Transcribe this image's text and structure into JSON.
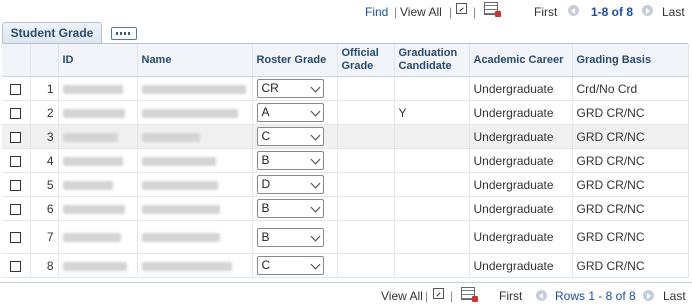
{
  "toolbar": {
    "find": "Find",
    "view_all": "View All",
    "separator": "|",
    "first": "First",
    "range": "1-8 of 8",
    "last": "Last"
  },
  "tab": {
    "label": "Student Grade"
  },
  "columns": [
    "ID",
    "Name",
    "Roster Grade",
    "Official Grade",
    "Graduation Candidate",
    "Academic Career",
    "Grading Basis"
  ],
  "rows": [
    {
      "num": "1",
      "roster_grade": "CR",
      "official_grade": "",
      "grad_candidate": "",
      "career": "Undergraduate",
      "basis": "Crd/No Crd"
    },
    {
      "num": "2",
      "roster_grade": "A",
      "official_grade": "",
      "grad_candidate": "Y",
      "career": "Undergraduate",
      "basis": "GRD CR/NC"
    },
    {
      "num": "3",
      "roster_grade": "C",
      "official_grade": "",
      "grad_candidate": "",
      "career": "Undergraduate",
      "basis": "GRD CR/NC"
    },
    {
      "num": "4",
      "roster_grade": "B",
      "official_grade": "",
      "grad_candidate": "",
      "career": "Undergraduate",
      "basis": "GRD CR/NC"
    },
    {
      "num": "5",
      "roster_grade": "D",
      "official_grade": "",
      "grad_candidate": "",
      "career": "Undergraduate",
      "basis": "GRD CR/NC"
    },
    {
      "num": "6",
      "roster_grade": "B",
      "official_grade": "",
      "grad_candidate": "",
      "career": "Undergraduate",
      "basis": "GRD CR/NC"
    },
    {
      "num": "7",
      "roster_grade": "B",
      "official_grade": "",
      "grad_candidate": "",
      "career": "Undergraduate",
      "basis": "GRD CR/NC"
    },
    {
      "num": "8",
      "roster_grade": "C",
      "official_grade": "",
      "grad_candidate": "",
      "career": "Undergraduate",
      "basis": "GRD CR/NC"
    }
  ],
  "footer": {
    "view_all": "View All",
    "separator": "|",
    "first": "First",
    "rows_range": "Rows 1 - 8 of 8",
    "last": "Last"
  }
}
